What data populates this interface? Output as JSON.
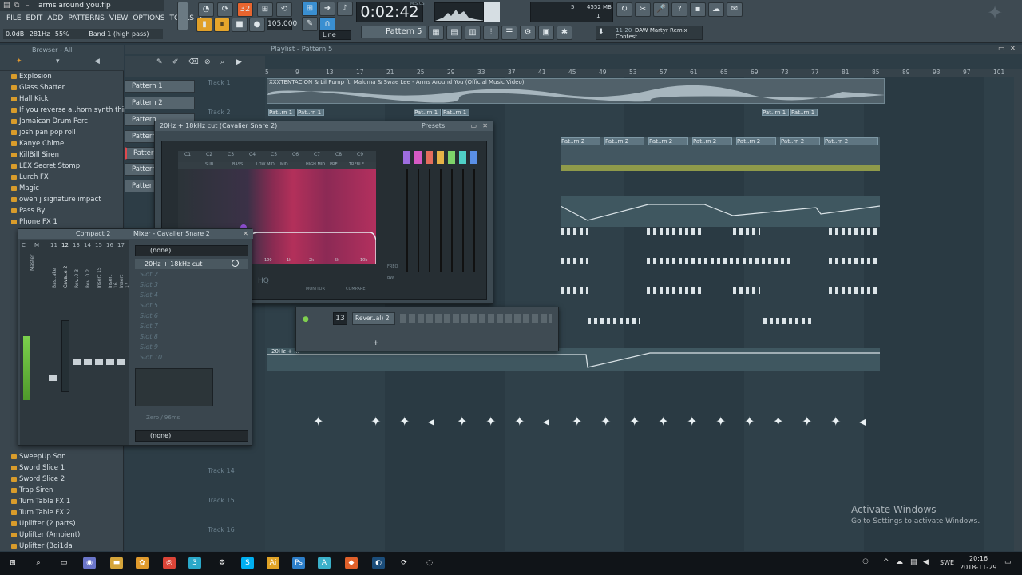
{
  "project": {
    "filename": "arms around you.flp"
  },
  "menu": [
    "FILE",
    "EDIT",
    "ADD",
    "PATTERNS",
    "VIEW",
    "OPTIONS",
    "TOOLS",
    "?"
  ],
  "hint_bar": {
    "level": "0.0dB",
    "freq": "281Hz",
    "pct": "55%",
    "band": "Band 1 (high pass)"
  },
  "transport": {
    "time": "0:02:42",
    "time_sub": "M:S:CS",
    "tempo": "105.000",
    "snap": "Line",
    "pattern": "Pattern 5",
    "cpu": "5",
    "mem": "4552 MB",
    "voices": "1"
  },
  "news": {
    "date": "11-20",
    "line1": "DAW Martyr Remix",
    "line2": "Contest"
  },
  "browser": {
    "header": "Browser - All",
    "items_top": [
      "Explosion",
      "Glass Shatter",
      "Hall Kick",
      "If you reverse a..horn synth thing",
      "Jamaican Drum Perc",
      "josh pan pop roll",
      "Kanye Chime",
      "KillBill Siren",
      "LEX Secret Stomp",
      "Lurch FX",
      "Magic",
      "owen j signature impact",
      "Pass By",
      "Phone FX 1"
    ],
    "items_bottom": [
      "SweepUp Son",
      "Sword Slice 1",
      "Sword Slice 2",
      "Trap Siren",
      "Turn Table FX 1",
      "Turn Table FX 2",
      "Uplifter (2 parts)",
      "Uplifter (Ambient)",
      "Uplifter (Boi1da"
    ]
  },
  "playlist": {
    "title": "Playlist - Pattern 5",
    "audio_clip": "XXXTENTACION & Lil Pump ft. Maluma & Swae Lee - Arms Around You (Official Music Video)",
    "tracks": [
      "Track 1",
      "Track 2",
      "Track 14",
      "Track 15",
      "Track 16"
    ],
    "ruler": [
      "5",
      "9",
      "13",
      "17",
      "21",
      "25",
      "29",
      "33",
      "37",
      "41",
      "45",
      "49",
      "53",
      "57",
      "61",
      "65",
      "69",
      "73",
      "77",
      "81",
      "85",
      "89",
      "93",
      "97",
      "101"
    ],
    "patterns": [
      "Pattern 1",
      "Pattern 2",
      "Pattern",
      "Pattern",
      "Pattern",
      "Pattern",
      "Pattern"
    ],
    "clip_label": "Pat..rn 2",
    "clip_label_b": "Pat..rn 1",
    "auto_clip": "20Hz + ..."
  },
  "eq": {
    "title": "20Hz + 18kHz cut (Cavalier Snare 2)",
    "presets": "Presets",
    "bands": [
      "C1",
      "C2",
      "C3",
      "C4",
      "C5",
      "C6",
      "C7",
      "C8",
      "C9"
    ],
    "zones": [
      "SUB",
      "BASS",
      "LOW MID",
      "MID",
      "HIGH MID",
      "PRE",
      "TREBLE"
    ],
    "freqs": [
      "100",
      "1k",
      "2k",
      "5k",
      "10k"
    ],
    "hq": "HQ",
    "monitor": "MONITOR",
    "compare": "COMPARE",
    "freq_lbl": "FREQ",
    "bw_lbl": "BW"
  },
  "channel": {
    "num": "13",
    "name": "Rever..al) 2"
  },
  "mixer": {
    "title": "Mixer - Cavalier Snare 2",
    "compact": "Compact 2",
    "input": "(none)",
    "output": "(none)",
    "slot1": "20Hz + 18kHz cut",
    "slots": [
      "Slot 2",
      "Slot 3",
      "Slot 4",
      "Slot 5",
      "Slot 6",
      "Slot 7",
      "Slot 8",
      "Slot 9",
      "Slot 10"
    ],
    "latency": "Zero / 96ms",
    "strips": [
      "Master",
      "Bas..ake",
      "Cava..e 2",
      "Rev..0 3",
      "Rev..0 2",
      "Insert 15",
      "Insert 16",
      "Insert 17"
    ],
    "strip_nums": [
      "C",
      "M",
      "11",
      "12",
      "13",
      "14",
      "15",
      "16",
      "17"
    ]
  },
  "watermark": {
    "title": "Activate Windows",
    "sub": "Go to Settings to activate Windows."
  },
  "taskbar": {
    "lang": "SWE",
    "time": "20:16",
    "date": "2018-11-29"
  }
}
